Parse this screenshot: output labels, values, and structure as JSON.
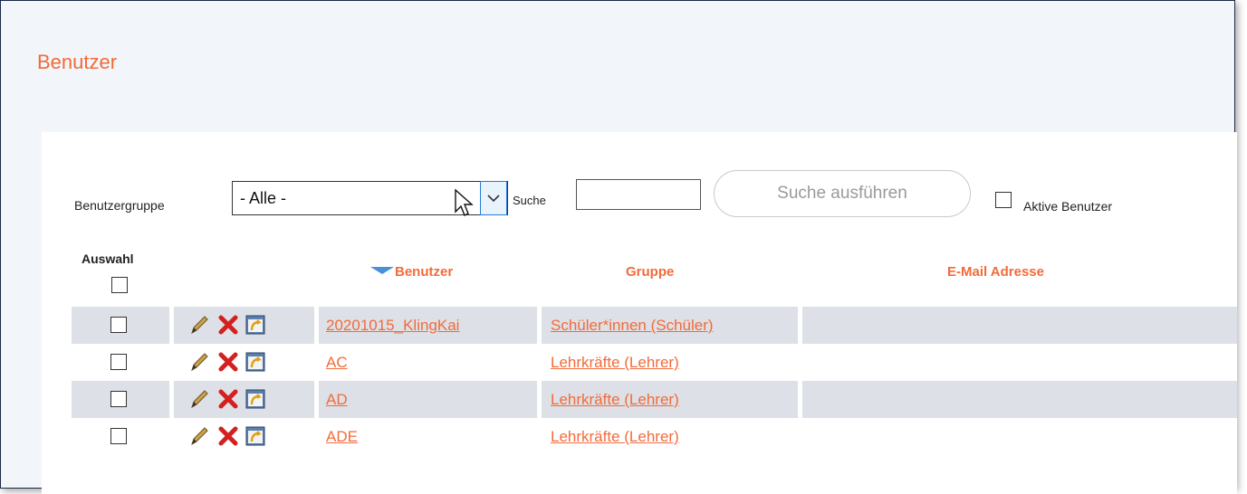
{
  "page": {
    "title": "Benutzer"
  },
  "filters": {
    "group_label": "Benutzergruppe",
    "group_selected": "- Alle -",
    "search_label": "Suche",
    "search_value": "",
    "search_button": "Suche ausführen",
    "active_label": "Aktive Benutzer",
    "active_checked": false
  },
  "table": {
    "select_header": "Auswahl",
    "columns": [
      "Benutzer",
      "Gruppe",
      "E-Mail Adresse"
    ],
    "sort_column": "Benutzer",
    "rows": [
      {
        "user": "20201015_KlingKai",
        "group": "Schüler*innen (Schüler)",
        "email": ""
      },
      {
        "user": "AC",
        "group": "Lehrkräfte (Lehrer)",
        "email": ""
      },
      {
        "user": "AD",
        "group": "Lehrkräfte (Lehrer)",
        "email": ""
      },
      {
        "user": "ADE",
        "group": "Lehrkräfte (Lehrer)",
        "email": ""
      }
    ]
  },
  "icons": {
    "edit": "pencil-icon",
    "delete": "red-x-icon",
    "login_as": "switch-user-icon"
  },
  "colors": {
    "accent": "#f26b3a",
    "row_shade": "#dde0e6",
    "background": "#f2f5f9"
  }
}
